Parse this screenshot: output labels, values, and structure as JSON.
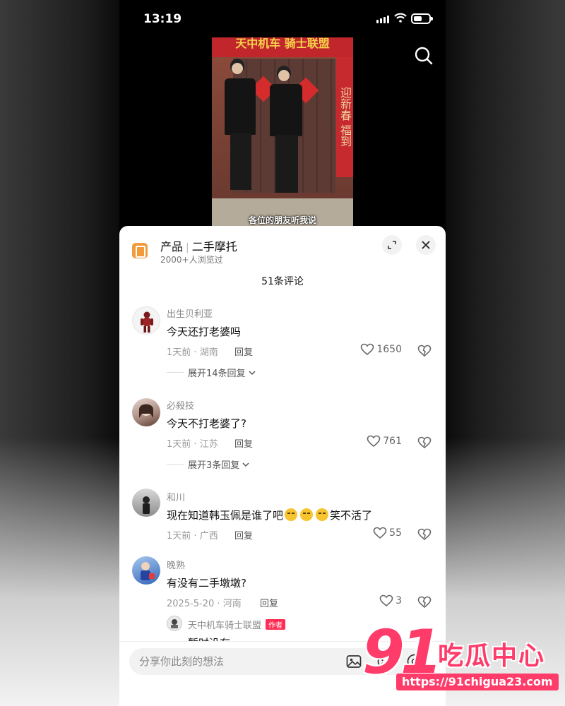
{
  "status_bar": {
    "time": "13:19"
  },
  "video": {
    "sign_text": "天中机车 骑士联盟",
    "couplet_text": "迎新春 福到",
    "subtitle": "各位的朋友听我说"
  },
  "sheet": {
    "product_label": "产品",
    "product_name": "二手摩托",
    "views": "2000+人浏览过",
    "comment_count": "51条评论"
  },
  "comments": [
    {
      "user": "出生贝利亚",
      "text": "今天还打老婆吗",
      "time": "1天前",
      "location": "湖南",
      "reply_label": "回复",
      "likes": "1650",
      "expand": "展开14条回复"
    },
    {
      "user": "必殺技",
      "text": "今天不打老婆了?",
      "time": "1天前",
      "location": "江苏",
      "reply_label": "回复",
      "likes": "761",
      "expand": "展开3条回复"
    },
    {
      "user": "和川",
      "text_before": "现在知道韩玉佩是谁了吧",
      "text_after": "笑不活了",
      "time": "1天前",
      "location": "广西",
      "reply_label": "回复",
      "likes": "55"
    },
    {
      "user": "晚熟",
      "text": "有没有二手墩墩?",
      "time": "2025-5-20",
      "location": "河南",
      "reply_label": "回复",
      "likes": "3"
    }
  ],
  "author_reply": {
    "user": "天中机车骑士联盟",
    "tag": "作者",
    "text": "暂时没有"
  },
  "input": {
    "placeholder": "分享你此刻的想法"
  },
  "watermark": {
    "number": "91",
    "name": "吃瓜中心",
    "url": "https://91chigua23.com"
  },
  "colors": {
    "accent": "#ff3b6a",
    "product_icon": "#f19b3a",
    "author_tag": "#ff2d55"
  },
  "icons": [
    "search-icon",
    "expand-icon",
    "close-icon",
    "heart-icon",
    "broken-heart-icon",
    "image-icon",
    "emoji-icon",
    "at-icon",
    "chevron-down-icon"
  ]
}
